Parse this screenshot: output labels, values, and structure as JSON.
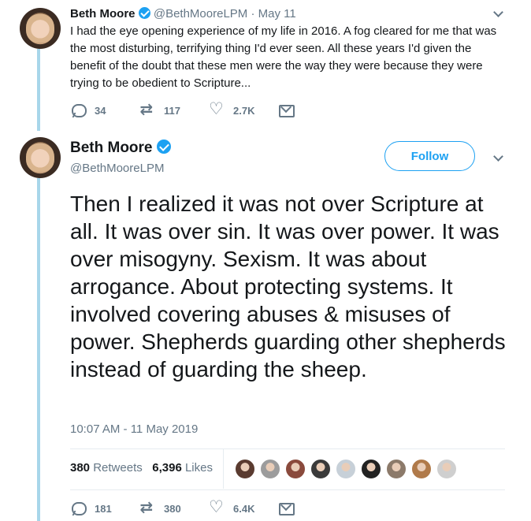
{
  "reply_tweet": {
    "name": "Beth Moore",
    "handle": "@BethMooreLPM",
    "separator": "·",
    "date": "May 11",
    "text": "I had the eye opening experience of my life in 2016. A fog cleared for me that was the most disturbing, terrifying thing I'd ever seen. All these years I'd given the benefit of the doubt that these men were the way they were because they were trying to be obedient to Scripture...",
    "replies": "34",
    "retweets": "117",
    "likes": "2.7K"
  },
  "main_tweet": {
    "name": "Beth Moore",
    "handle": "@BethMooreLPM",
    "follow_label": "Follow",
    "text": "Then I realized it was not over Scripture at all. It was over sin. It was over power. It was over misogyny. Sexism. It was about arrogance. About protecting systems.  It involved covering abuses & misuses of power. Shepherds guarding other shepherds instead of guarding the sheep.",
    "timestamp": "10:07 AM - 11 May 2019",
    "retweet_count": "380",
    "retweet_label": "Retweets",
    "like_count": "6,396",
    "like_label": "Likes",
    "replies": "181",
    "retweets": "380",
    "likes": "6.4K"
  },
  "likers": [
    {
      "color": "#5a3b30"
    },
    {
      "color": "#9c9c9c"
    },
    {
      "color": "#8a4a3c"
    },
    {
      "color": "#3a3a3a"
    },
    {
      "color": "#c7d0d8"
    },
    {
      "color": "#222222"
    },
    {
      "color": "#8c7a6a"
    },
    {
      "color": "#b07a4a"
    },
    {
      "color": "#cfcfcf"
    }
  ],
  "colors": {
    "accent": "#1da1f2",
    "secondary_text": "#657786",
    "thread_line": "#a8d6ea"
  }
}
